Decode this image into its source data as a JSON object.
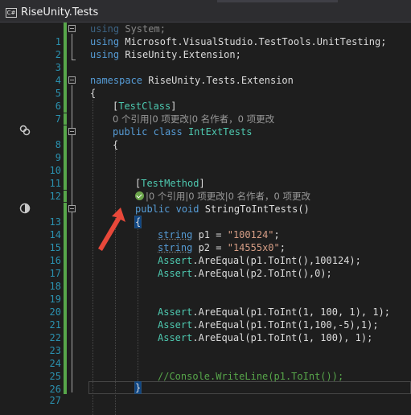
{
  "window": {
    "project_icon_label": "C#",
    "title": "RiseUnity.Tests"
  },
  "colors": {
    "background": "#1e1e1e",
    "line_number": "#2b91af",
    "keyword": "#569cd6",
    "type": "#4ec9b0",
    "string": "#d69d85",
    "comment": "#57a64a",
    "codelens": "#999999",
    "annotation_arrow": "#e8483a"
  },
  "codelens": {
    "class_lens": "0 个引用|0 项更改|0 名作者，0 项更改",
    "method_lens": "|0 个引用|0 项更改|0 名作者，0 项更改"
  },
  "lines": {
    "l1": {
      "num": "1",
      "k": "using",
      "rest": " System;"
    },
    "l2": {
      "num": "2",
      "k": "using",
      "rest": " Microsoft.VisualStudio.TestTools.UnitTesting;"
    },
    "l3": {
      "num": "3",
      "k": "using",
      "rest": " RiseUnity.Extension;"
    },
    "l4": {
      "num": "4"
    },
    "l5": {
      "num": "5",
      "k": "namespace",
      "rest": " RiseUnity.Tests.Extension"
    },
    "l6": {
      "num": "6",
      "rest": "{"
    },
    "l7": {
      "num": "7",
      "p1": "[",
      "attr": "TestClass",
      "p2": "]"
    },
    "l8": {
      "num": "8",
      "k1": "public",
      "k2": "class",
      "name": "IntExtTests"
    },
    "l9": {
      "num": "9",
      "rest": "{"
    },
    "l10": {
      "num": "10"
    },
    "l11": {
      "num": "11"
    },
    "l12": {
      "num": "12",
      "p1": "[",
      "attr": "TestMethod",
      "p2": "]"
    },
    "l13": {
      "num": "13",
      "k1": "public",
      "k2": "void",
      "rest": " StringToIntTests()"
    },
    "l14": {
      "num": "14",
      "brace": "{"
    },
    "l15": {
      "num": "15",
      "k": "string",
      "var": " p1 = ",
      "str": "\"100124\"",
      "end": ";"
    },
    "l16": {
      "num": "16",
      "k": "string",
      "var": " p2 = ",
      "str": "\"14555x0\"",
      "end": ";"
    },
    "l17": {
      "num": "17",
      "ty": "Assert",
      "rest": ".AreEqual(p1.ToInt(),100124);"
    },
    "l18": {
      "num": "18",
      "ty": "Assert",
      "rest": ".AreEqual(p2.ToInt(),0);"
    },
    "l19": {
      "num": "19"
    },
    "l20": {
      "num": "20"
    },
    "l21": {
      "num": "21",
      "ty": "Assert",
      "rest": ".AreEqual(p1.ToInt(1, 100, 1), 1);"
    },
    "l22": {
      "num": "22",
      "ty": "Assert",
      "rest": ".AreEqual(p1.ToInt(1,100,-5),1);"
    },
    "l23": {
      "num": "23",
      "ty": "Assert",
      "rest": ".AreEqual(p1.ToInt(1, 100), 1);"
    },
    "l24": {
      "num": "24"
    },
    "l25": {
      "num": "25"
    },
    "l26": {
      "num": "26",
      "comment": "//Console.WriteLine(p1.ToInt());"
    },
    "l27": {
      "num": "27",
      "brace": "}"
    }
  }
}
